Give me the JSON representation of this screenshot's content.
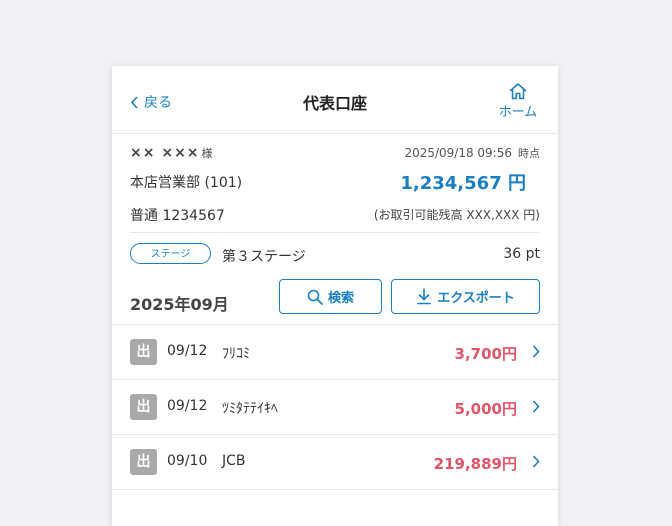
{
  "header": {
    "back_label": "戻る",
    "title": "代表口座",
    "home_label": "ホーム"
  },
  "account": {
    "holder_name": "×× ×××",
    "honorific": "様",
    "datetime": "2025/09/18 09:56",
    "as_of_suffix": "時点",
    "branch": "本店営業部 (101)",
    "balance": "1,234,567 円",
    "account_type_number": "普通 1234567",
    "available_note": "(お取引可能残高 XXX,XXX 円)"
  },
  "stage": {
    "badge": "ステージ",
    "name": "第３ステージ",
    "points": "36 pt"
  },
  "month_label": "2025年09月",
  "buttons": {
    "search_label": "検索",
    "export_label": "エクスポート"
  },
  "transactions": [
    {
      "kind": "出",
      "date": "09/12",
      "description": "ﾌﾘｺﾐ",
      "amount": "3,700円"
    },
    {
      "kind": "出",
      "date": "09/12",
      "description": "ﾂﾐﾀﾃﾃｲｷﾍ",
      "amount": "5,000円"
    },
    {
      "kind": "出",
      "date": "09/10",
      "description": "JCB",
      "amount": "219,889円"
    }
  ],
  "colors": {
    "accent": "#1a7fc1",
    "debit_amount": "#e0556a",
    "page_background": "#eff1f5"
  },
  "icons": [
    "chevron-left-icon",
    "home-icon",
    "search-icon",
    "download-icon",
    "chevron-right-icon"
  ]
}
